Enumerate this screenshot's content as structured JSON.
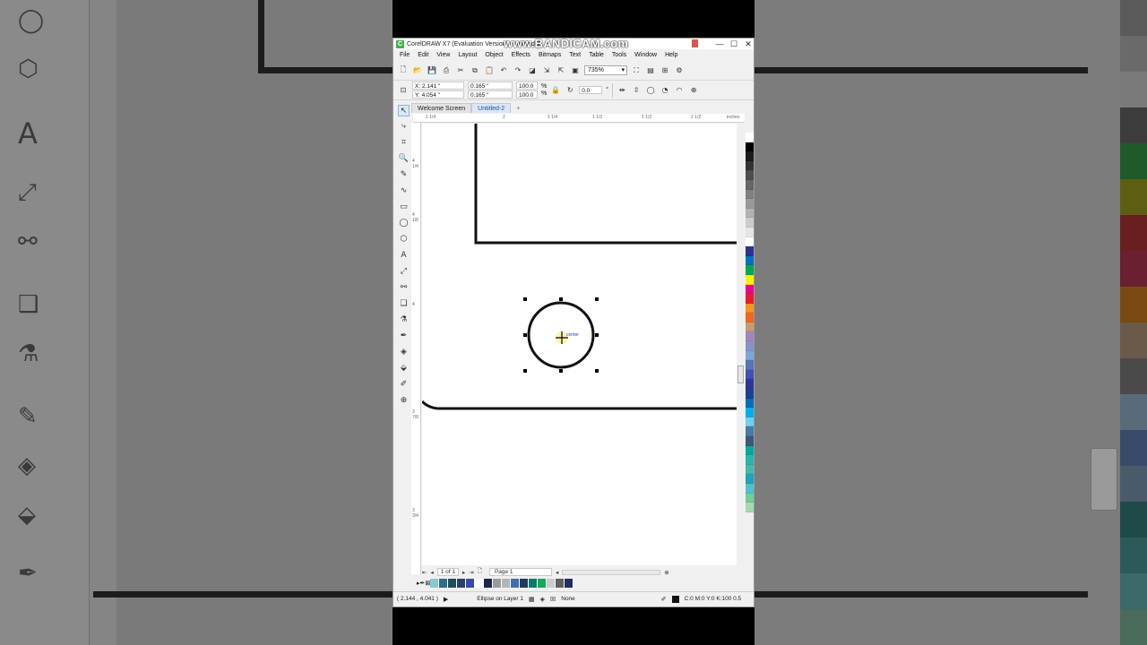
{
  "app": {
    "title": "CorelDRAW X7 (Evaluation Version) - Untitled-2",
    "watermark": "www.BANDICAM.com",
    "logo_letter": "C",
    "window_buttons": [
      "—",
      "☐",
      "✕"
    ]
  },
  "menu": [
    "File",
    "Edit",
    "View",
    "Layout",
    "Object",
    "Effects",
    "Bitmaps",
    "Text",
    "Table",
    "Tools",
    "Window",
    "Help"
  ],
  "toolbar": {
    "zoom": "735%"
  },
  "property_bar": {
    "x": "X: 2.141 \"",
    "y": "Y: 4.054 \"",
    "w": "0.165 \"",
    "h": "0.165 \"",
    "scale_w": "100.0",
    "scale_h": "100.0",
    "pct1": "%",
    "pct2": "%",
    "rotation": "0.0",
    "deg": "°"
  },
  "tabs": [
    {
      "label": "Welcome Screen",
      "active": false
    },
    {
      "label": "Untitled-2",
      "active": true
    }
  ],
  "ruler": {
    "units": "inches",
    "h_ticks": [
      "1 1/4",
      "2",
      "1 1/4",
      "1 1/2",
      "1 1/2",
      "2",
      "2 1/2"
    ],
    "v_ticks": [
      "4",
      "4 1/2",
      "4 3/8",
      "4 1/4",
      "4 1/8",
      "4",
      "3 7/8",
      "3 3/4",
      "3 5/8",
      "3 1/2"
    ]
  },
  "canvas": {
    "snap_label": "center"
  },
  "page_nav": {
    "counter": "1 of 1",
    "page_tab": "Page 1"
  },
  "status": {
    "coords": "( 2.144 , 4.041 )",
    "object": "Ellipse on Layer 1",
    "fill": "None",
    "outline": "C:0 M:0 Y:0 K:100  0.5"
  },
  "colors": {
    "accent": "#1d4ea0",
    "palette": [
      "#ffffff",
      "#000000",
      "#1a1a1a",
      "#333333",
      "#4d4d4d",
      "#666666",
      "#808080",
      "#999999",
      "#b3b3b3",
      "#cccccc",
      "#e6e6e6",
      "#ffffff",
      "#2e3192",
      "#0071bc",
      "#00a651",
      "#fff200",
      "#ec008c",
      "#ed1c24",
      "#f7941d",
      "#f26522",
      "#c69c6d",
      "#a186be",
      "#8493ca",
      "#7da7d9",
      "#5674b9",
      "#3f51b5",
      "#2f3699",
      "#1c3f94",
      "#006eb4",
      "#00aeef",
      "#6dcff6",
      "#4a7ba8",
      "#3a5a78",
      "#00a99d",
      "#2bb5a6",
      "#46b8b0",
      "#1fa4b8",
      "#4fc0d0",
      "#6fcf97",
      "#a8d8b0"
    ],
    "swatches": [
      "#8ec6d0",
      "#2a6d8c",
      "#1e4d5c",
      "#2d3f66",
      "#3b4aa8",
      "#ffffff",
      "#1b2a44",
      "#9a9a9a",
      "#b5b5b5",
      "#3f6fb0",
      "#1f3a5a",
      "#0b7a6a",
      "#11aa55",
      "#cccccc",
      "#5f5f5f",
      "#1d3060"
    ]
  }
}
